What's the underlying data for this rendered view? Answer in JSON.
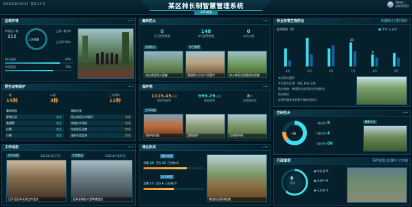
{
  "header": {
    "title": "某区林长制智慧管理系统",
    "subtitle": "工作动态",
    "datetime": "2022/4/24 09:47",
    "weather": "多云 24°C",
    "user": "Admin",
    "user_sub": "超级管理员"
  },
  "forest_chief": {
    "title": "总林护林",
    "center_label": "上次巡查",
    "count_label": "护林员人数",
    "count": "212",
    "stats": [
      {
        "label": "上周人数",
        "value": "85"
      },
      {
        "label": "上月率",
        "value": "60%"
      }
    ],
    "bars": [
      {
        "label": "例行巡检",
        "pct": "80%",
        "ratio": 0.8
      },
      {
        "label": "专项巡检",
        "pct": "70%",
        "ratio": 0.7
      }
    ],
    "photo_caption": ""
  },
  "forest_fire": {
    "title": "森林防火",
    "kpis": [
      {
        "value": "0",
        "label": "今日报警数量"
      },
      {
        "value": "148",
        "label": "本月报警数量"
      },
      {
        "value": "0",
        "label": "本月火情"
      }
    ],
    "tags": [
      "远程防火",
      "今日报警"
    ],
    "photos": [
      {
        "caption": "松山林区防火巡查"
      },
      {
        "caption": "国道防火卡点人员值守"
      },
      {
        "caption": "核心林区远程监测点巡查"
      }
    ]
  },
  "pest": {
    "title": "林业有害生物防治",
    "subtitle": "监测数据（株）",
    "links": [
      "年度统计",
      "按月统计"
    ],
    "legend": [
      "今年",
      "去年"
    ],
    "months": [
      "4月",
      "5月",
      "6月",
      "7月",
      "8月",
      "9月"
    ],
    "series": [
      {
        "name": "今年",
        "values": [
          60,
          95,
          60,
          80,
          40,
          45
        ]
      },
      {
        "name": "去年",
        "values": [
          20,
          40,
          70,
          50,
          30,
          30
        ]
      }
    ],
    "labels": [
      "20",
      "8"
    ],
    "items": [
      "本月防治面积",
      "本月发生区域：林区 林场 山地",
      "防治措施：物理防治化学防治生物防治",
      "监测点位：",
      "防治情况",
      "近期开展林业有害生物综合防治"
    ]
  },
  "wildlife": {
    "title": "野生动物保护",
    "kpis": [
      {
        "label": "一级",
        "value": "15种"
      },
      {
        "label": "二级",
        "value": "3种"
      },
      {
        "label": "三有保护",
        "value": "12种"
      }
    ],
    "list_left_title": "最新发现",
    "list_right_title": "观测记录",
    "rows_left": [
      [
        "野猪出没",
        "安全"
      ],
      [
        "普通鵟",
        "安全"
      ],
      [
        "白鹭",
        "安全"
      ],
      [
        "小麂",
        "安全"
      ]
    ],
    "rows_right": [
      [
        "西山林区红外相机",
        "完成"
      ],
      [
        "北坡红外相机",
        "完成"
      ],
      [
        "东部林区巡查",
        "完成"
      ],
      [
        "湿地鸟类监测",
        "完成"
      ]
    ]
  },
  "protection": {
    "title": "保护地",
    "kpis": [
      {
        "value": "1119.45",
        "unit": "公顷",
        "label": "保护地面积"
      },
      {
        "value": "999.79",
        "unit": "公顷",
        "label": "湿地面积"
      },
      {
        "value": "8",
        "unit": "个",
        "label": "自然保护区"
      }
    ],
    "tag": "工作动态",
    "photos": [
      {
        "caption": "保护地风貌"
      },
      {
        "caption": "湿地巡护"
      },
      {
        "caption": "沿海防护林"
      }
    ]
  },
  "assets": {
    "title": "古树名木",
    "center": "一级",
    "items": [
      {
        "label": "一级古树",
        "value": "8"
      },
      {
        "label": "二级古树",
        "value": "4"
      },
      {
        "label": "三级古树",
        "value": "66"
      }
    ],
    "tag": "最新名木",
    "photo": {
      "caption": ""
    }
  },
  "work": {
    "title": "工作动态",
    "date_left": "2022年3月17日",
    "date_right": "2021年7月22日",
    "tab_left": "工作动态",
    "tab_right": "工作会议",
    "captions": [
      "召开全区林长制工作会议",
      "区林长制办公室联席会议"
    ]
  },
  "patrol": {
    "title": "林业执法",
    "rows": [
      {
        "label": "总数",
        "v1": "18",
        "l2": "已办",
        "v2": "13",
        "l3": "已办结",
        "v3": "0"
      },
      {
        "label": "总数",
        "v1": "12",
        "l2": "已办",
        "v2": "6",
        "l3": "已办结",
        "v3": "0"
      }
    ],
    "tabs": [
      "案件处理",
      "执法检查"
    ],
    "photo_caption": "林业执法现场检查"
  },
  "events": {
    "title": "行政事项",
    "links": [
      "事件受理",
      "处理中",
      "已办结"
    ],
    "total_label": "总计",
    "total": "8",
    "items": [
      {
        "label": "待处理",
        "value": "5"
      },
      {
        "label": "处理中",
        "value": "0"
      },
      {
        "label": "已办结",
        "value": "3"
      }
    ],
    "photo_caption": ""
  }
}
